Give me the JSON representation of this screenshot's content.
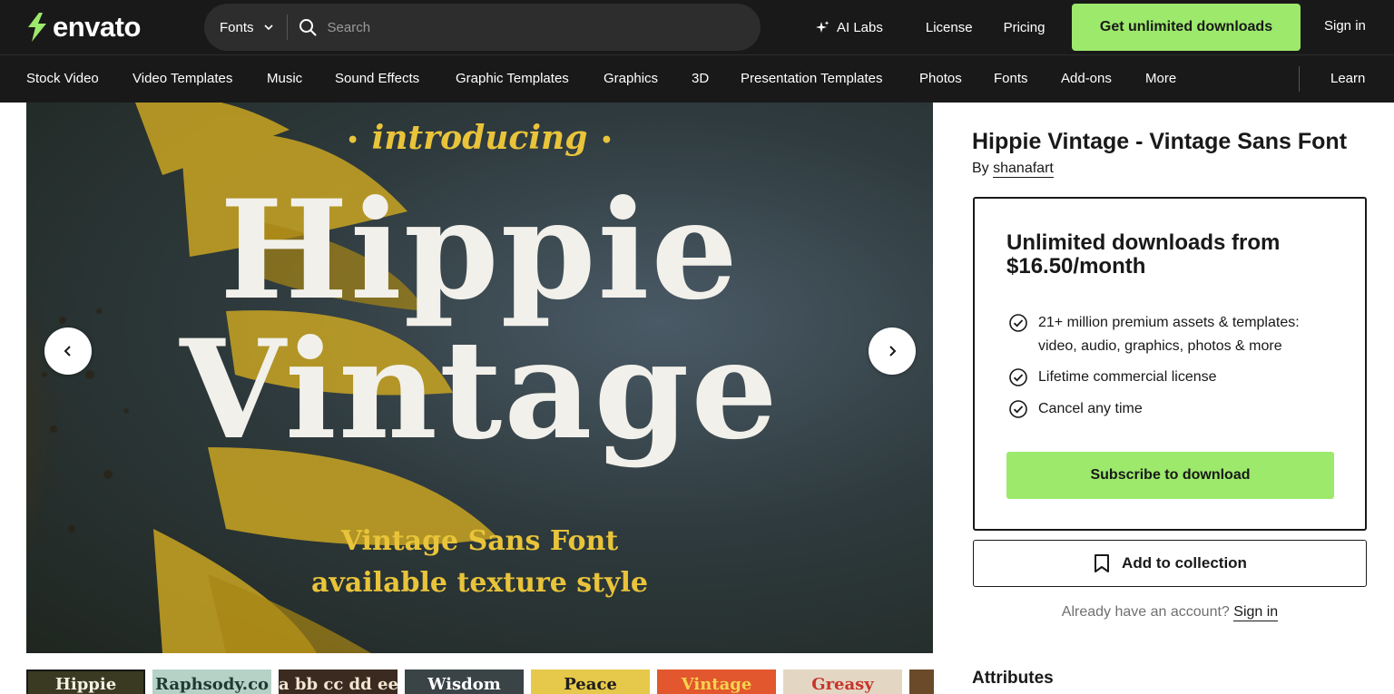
{
  "header": {
    "logo_text": "envato",
    "search": {
      "category": "Fonts",
      "placeholder": "Search"
    },
    "links": {
      "ai_labs": "AI Labs",
      "license": "License",
      "pricing": "Pricing"
    },
    "cta": "Get unlimited downloads",
    "sign_in": "Sign in"
  },
  "nav": {
    "items": [
      "Stock Video",
      "Video Templates",
      "Music",
      "Sound Effects",
      "Graphic Templates",
      "Graphics",
      "3D",
      "Presentation Templates",
      "Photos",
      "Fonts",
      "Add-ons",
      "More"
    ],
    "learn": "Learn"
  },
  "preview": {
    "introducing": "introducing",
    "word1": "Hippie",
    "word2": "Vintage",
    "tagline1": "Vintage Sans Font",
    "tagline2": "available texture style"
  },
  "thumbnails": [
    {
      "label": "Hippie",
      "bg": "#3a3a22",
      "fg": "#f2efe4",
      "active": true
    },
    {
      "label": "Raphsody.co",
      "bg": "#b6d1c6",
      "fg": "#1f3a33"
    },
    {
      "label": "a bb cc dd ee ff gg",
      "bg": "#3b2a20",
      "fg": "#f0e6d2"
    },
    {
      "label": "Wisdom",
      "bg": "#3a4346",
      "fg": "#ffffff"
    },
    {
      "label": "Peace",
      "bg": "#e6c84a",
      "fg": "#1d1d1d"
    },
    {
      "label": "Vintage",
      "bg": "#e2572d",
      "fg": "#f6d34e"
    },
    {
      "label": "Greasy",
      "bg": "#e3d7c4",
      "fg": "#c6352b"
    }
  ],
  "product": {
    "title": "Hippie Vintage - Vintage Sans Font",
    "by": "By",
    "author": "shanafart"
  },
  "subscription": {
    "heading": "Unlimited downloads from $16.50/month",
    "features": [
      "21+ million premium assets & templates: video, audio, graphics, photos & more",
      "Lifetime commercial license",
      "Cancel any time"
    ],
    "subscribe_label": "Subscribe to download"
  },
  "collection_label": "Add to collection",
  "account": {
    "prompt": "Already have an account?",
    "sign_in": "Sign in"
  },
  "attributes_heading": "Attributes",
  "colors": {
    "brand_green": "#9ce96b",
    "header_bg": "#191919",
    "accent_yellow": "#e9c43a"
  }
}
